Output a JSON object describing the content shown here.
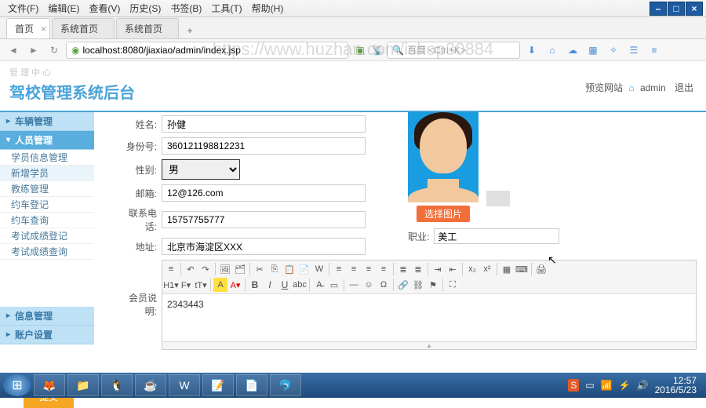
{
  "menubar": {
    "items": [
      "文件(F)",
      "编辑(E)",
      "查看(V)",
      "历史(S)",
      "书签(B)",
      "工具(T)",
      "帮助(H)"
    ]
  },
  "tabs": {
    "items": [
      {
        "label": "首页"
      },
      {
        "label": "系统首页"
      },
      {
        "label": "系统首页"
      }
    ]
  },
  "url": "localhost:8080/jiaxiao/admin/index.jsp",
  "searchhint": "百度 <Ctrl+K>",
  "watermark": "https://www.huzhan.com/ishop30884",
  "header": {
    "crumbs": "管理中心",
    "title": "驾校管理系统后台",
    "preview": "预览网站",
    "user": "admin",
    "logout": "退出"
  },
  "sidebar": {
    "groups": [
      {
        "label": "车辆管理",
        "open": false
      },
      {
        "label": "人员管理",
        "open": true,
        "items": [
          {
            "label": "学员信息管理"
          },
          {
            "label": "新增学员",
            "sel": true
          },
          {
            "label": "教练管理"
          },
          {
            "label": "约车登记"
          },
          {
            "label": "约车查询"
          },
          {
            "label": "考试成绩登记"
          },
          {
            "label": "考试成绩查询"
          }
        ]
      },
      {
        "label": "信息管理",
        "open": false
      },
      {
        "label": "账户设置",
        "open": false
      }
    ]
  },
  "form": {
    "name_label": "姓名:",
    "name": "孙健",
    "id_label": "身份号:",
    "id": "360121198812231",
    "gender_label": "性别:",
    "gender": "男",
    "email_label": "邮箱:",
    "email": "12@126.com",
    "phone_label": "联系电话:",
    "phone": "15757755777",
    "addr_label": "地址:",
    "addr": "北京市海淀区XXX",
    "job_label": "职业:",
    "job": "美工",
    "desc_label": "会员说明:",
    "photo_btn": "选择图片",
    "editor_content": "2343443",
    "submit": "提交"
  },
  "taskbar": {
    "time": "12:57",
    "date": "2016/5/23"
  }
}
